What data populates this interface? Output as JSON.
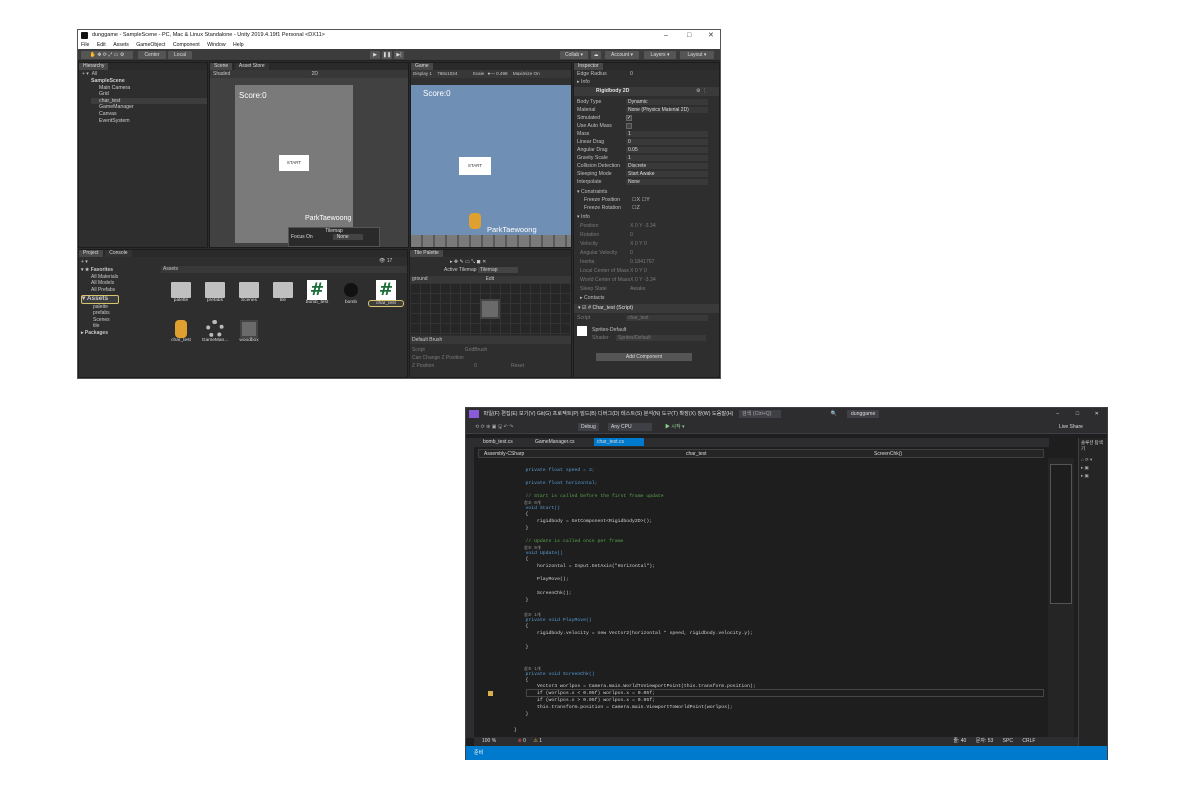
{
  "unity": {
    "title": "dunggame - SampleScene - PC, Mac & Linux Standalone - Unity 2019.4.19f1 Personal <DX11>",
    "menu": [
      "File",
      "Edit",
      "Assets",
      "GameObject",
      "Component",
      "Window",
      "Help"
    ],
    "toolbar": {
      "center": "Center",
      "local": "Local",
      "collab": "Collab ▾",
      "account": "Account ▾",
      "layers": "Layers ▾",
      "layout": "Layout ▾"
    },
    "hierarchy": {
      "tab": "Hierarchy",
      "search": "All",
      "items": [
        "SampleScene",
        "Main Camera",
        "Grid",
        "char_test",
        "GameManager",
        "Canvas",
        "EventSystem"
      ]
    },
    "scene": {
      "tabs": [
        "Scene",
        "Asset Store"
      ],
      "shaded": "Shaded",
      "mode2d": "2D",
      "score": "Score:0",
      "start": "START",
      "name": "ParkTaewoong",
      "tilemap_label": "Tilemap",
      "focus_on": "Focus On",
      "focus_value": "None"
    },
    "game": {
      "tab": "Game",
      "display": "Display 1",
      "resolution": "768x1024",
      "scale_label": "Scale",
      "scale_value": "0.498",
      "maximize": "Maximize On",
      "score": "Score:0",
      "start": "START",
      "name": "ParkTaewoong"
    },
    "inspector": {
      "tab": "Inspector",
      "edge_radius": "Edge Radius",
      "edge_radius_value": "0",
      "info": "Info",
      "component": "Rigidbody 2D",
      "props": [
        {
          "label": "Body Type",
          "value": "Dynamic"
        },
        {
          "label": "Material",
          "value": "None (Physics Material 2D)"
        },
        {
          "label": "Simulated",
          "value": "✓"
        },
        {
          "label": "Use Auto Mass",
          "value": ""
        },
        {
          "label": "Mass",
          "value": "1"
        },
        {
          "label": "Linear Drag",
          "value": "0"
        },
        {
          "label": "Angular Drag",
          "value": "0.05"
        },
        {
          "label": "Gravity Scale",
          "value": "1"
        },
        {
          "label": "Collision Detection",
          "value": "Discrete"
        },
        {
          "label": "Sleeping Mode",
          "value": "Start Awake"
        },
        {
          "label": "Interpolate",
          "value": "None"
        }
      ],
      "constraints": "Constraints",
      "freeze_position": "Freeze Position",
      "freeze_rotation": "Freeze Rotation",
      "fx": "X",
      "fy": "Y",
      "fz": "Z",
      "info2": "Info",
      "info_rows": [
        {
          "label": "Position",
          "value": "X 0    Y -3.34"
        },
        {
          "label": "Rotation",
          "value": "0"
        },
        {
          "label": "Velocity",
          "value": "X 0    Y 0"
        },
        {
          "label": "Angular Velocity",
          "value": "0"
        },
        {
          "label": "Inertia",
          "value": "0.1841767"
        },
        {
          "label": "Local Center of Mass",
          "value": "X 0    Y 0"
        },
        {
          "label": "World Center of Mass",
          "value": "X 0    Y -3.34"
        },
        {
          "label": "Sleep State",
          "value": "Awake"
        }
      ],
      "contacts": "Contacts",
      "script_component": "Char_test (Script)",
      "script_label": "Script",
      "script_value": "char_test",
      "material": "Sprites-Default",
      "shader_label": "Shader",
      "shader_value": "Sprites/Default",
      "add_component": "Add Component"
    },
    "project": {
      "tabs": [
        "Project",
        "Console"
      ],
      "favorites": "Favorites",
      "fav_items": [
        "All Materials",
        "All Models",
        "All Prefabs"
      ],
      "assets": "Assets",
      "asset_folders": [
        "palette",
        "prefabs",
        "Scenes",
        "tile"
      ],
      "packages": "Packages",
      "breadcrumb": "Assets",
      "count": "17",
      "files": [
        "palette",
        "prefabs",
        "Scenes",
        "tile",
        "bomb_test",
        "bomb",
        "char_test",
        "char_test",
        "GameMan...",
        "woodbox"
      ]
    },
    "tile_palette": {
      "tab": "Tile Palette",
      "active_tilemap": "Active Tilemap",
      "tilemap_value": "Tilemap",
      "ground": "ground",
      "edit": "Edit",
      "brush": "Default Brush",
      "script_label": "Script",
      "script_value": "GridBrush",
      "can_change": "Can Change Z Position",
      "z_pos": "Z Position",
      "z_value": "0",
      "reset": "Reset"
    }
  },
  "vs": {
    "menu": [
      "파일(F)",
      "편집(E)",
      "보기(V)",
      "Git(G)",
      "프로젝트(P)",
      "빌드(B)",
      "디버그(D)",
      "테스트(S)",
      "분석(N)",
      "도구(T)",
      "확장(X)",
      "창(W)",
      "도움말(H)"
    ],
    "search": "검색 (Ctrl+Q)",
    "project_name": "dunggame",
    "debug": "Debug",
    "cpu": "Any CPU",
    "start": "▶ 시작 ▾",
    "liveshare": "Live Share",
    "tabs": [
      "bomb_test.cs",
      "GameManager.cs",
      "char_test.cs"
    ],
    "nav": [
      "Assembly-CSharp",
      "char_test",
      "ScreenChk()"
    ],
    "code": [
      {
        "t": "    private float speed = 3;",
        "c": "kw"
      },
      {
        "t": "    private float horizontal;",
        "c": "kw"
      },
      {
        "t": "    // Start is called before the first frame update",
        "c": "cm"
      },
      {
        "t": "    참조 0개",
        "c": "ref"
      },
      {
        "t": "    void Start()",
        "c": "kw"
      },
      {
        "t": "    {",
        "c": ""
      },
      {
        "t": "        rigidbody = GetComponent<Rigidbody2D>();",
        "c": ""
      },
      {
        "t": "    }",
        "c": ""
      },
      {
        "t": "    // Update is called once per frame",
        "c": "cm"
      },
      {
        "t": "    참조 0개",
        "c": "ref"
      },
      {
        "t": "    void Update()",
        "c": "kw"
      },
      {
        "t": "    {",
        "c": ""
      },
      {
        "t": "        horizontal = Input.GetAxis(\"Horizontal\");",
        "c": ""
      },
      {
        "t": "        PlayMove();",
        "c": ""
      },
      {
        "t": "        ScreenChk();",
        "c": ""
      },
      {
        "t": "    }",
        "c": ""
      },
      {
        "t": "    참조 1개",
        "c": "ref"
      },
      {
        "t": "    private void PlayMove()",
        "c": "kw"
      },
      {
        "t": "    {",
        "c": ""
      },
      {
        "t": "        rigidbody.velocity = new Vector2(horizontal * speed, rigidbody.velocity.y);",
        "c": ""
      },
      {
        "t": "    }",
        "c": ""
      },
      {
        "t": "    참조 1개",
        "c": "ref"
      },
      {
        "t": "    private void ScreenChk()",
        "c": "kw"
      },
      {
        "t": "    {",
        "c": ""
      },
      {
        "t": "        Vector3 worlpos = Camera.main.WorldToViewportPoint(this.transform.position);",
        "c": ""
      },
      {
        "t": "        if (worlpos.x < 0.05f) worlpos.x = 0.05f;",
        "c": ""
      },
      {
        "t": "        if (worlpos.x > 0.95f) worlpos.x = 0.95f;",
        "c": ""
      },
      {
        "t": "        this.transform.position = Camera.main.ViewportToWorldPoint(worlpos);",
        "c": ""
      },
      {
        "t": "    }",
        "c": ""
      },
      {
        "t": "}",
        "c": ""
      }
    ],
    "status": {
      "zoom": "100 %",
      "errors": "0",
      "warnings": "1",
      "ready": "준비",
      "line": "줄: 40",
      "col": "문자: 53",
      "spc": "SPC",
      "crlf": "CRLF"
    },
    "solution_title": "솔루션 탐색기"
  }
}
